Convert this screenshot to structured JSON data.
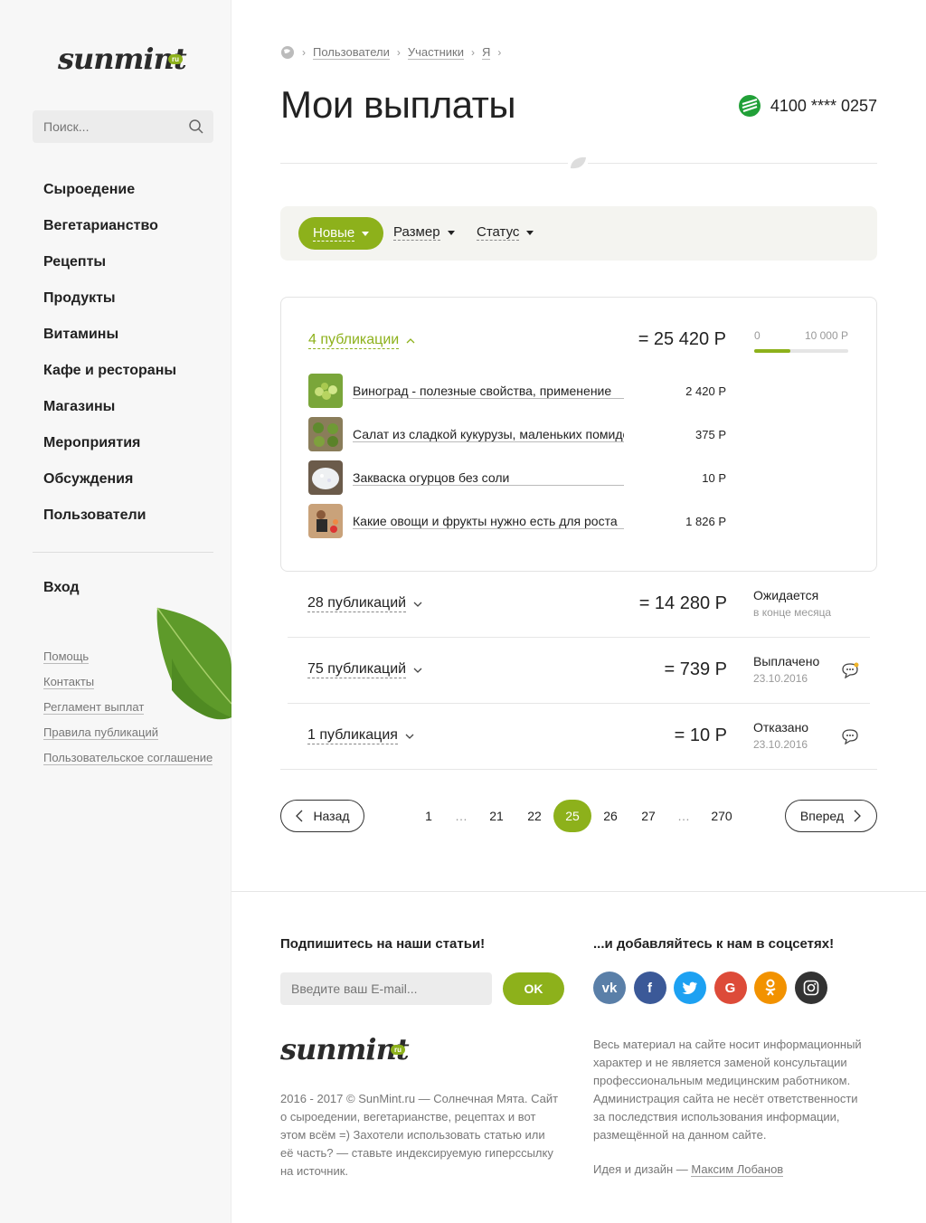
{
  "sidebar": {
    "logo_text": "sunmint",
    "logo_badge": "ru",
    "search_placeholder": "Поиск...",
    "nav": [
      "Сыроедение",
      "Вегетарианство",
      "Рецепты",
      "Продукты",
      "Витамины",
      "Кафе и рестораны",
      "Магазины",
      "Мероприятия",
      "Обсуждения",
      "Пользователи"
    ],
    "login": "Вход",
    "links": [
      "Помощь",
      "Контакты",
      "Регламент выплат",
      "Правила публикаций",
      "Пользовательское соглашение"
    ]
  },
  "breadcrumb": [
    "Пользователи",
    "Участники",
    "Я"
  ],
  "page_title": "Мои выплаты",
  "card_number": "4100 **** 0257",
  "filters": {
    "new": "Новые",
    "size": "Размер",
    "status": "Статус"
  },
  "expanded_group": {
    "label": "4 публикации",
    "amount": "= 25 420 Р",
    "progress": {
      "min": "0",
      "max": "10 000 Р",
      "fraction": 0.38
    },
    "items": [
      {
        "title": "Виноград - полезные свойства, применение",
        "value": "2 420 Р"
      },
      {
        "title": "Салат из сладкой кукурузы, маленьких помидоров",
        "value": "375 Р"
      },
      {
        "title": "Закваска огурцов без соли",
        "value": "10 Р"
      },
      {
        "title": "Какие овощи и фрукты нужно есть для роста",
        "value": "1 826 Р"
      }
    ]
  },
  "groups": [
    {
      "label": "28 публикаций",
      "amount": "= 14 280 Р",
      "status": "Ожидается",
      "sub": "в конце месяца"
    },
    {
      "label": "75 публикаций",
      "amount": "= 739 Р",
      "status": "Выплачено",
      "sub": "23.10.2016"
    },
    {
      "label": "1 публикация",
      "amount": "= 10 Р",
      "status": "Отказано",
      "sub": "23.10.2016"
    }
  ],
  "pager": {
    "prev": "Назад",
    "next": "Вперед",
    "pages": [
      "1",
      "…",
      "21",
      "22",
      "25",
      "26",
      "27",
      "…",
      "270"
    ],
    "current": "25"
  },
  "footer": {
    "subscribe_heading": "Подпишитесь на наши статьи!",
    "social_heading": "...и добавляйтесь к нам в соцсетях!",
    "email_placeholder": "Введите ваш E-mail...",
    "ok": "OK",
    "copyright": "2016 - 2017 © SunMint.ru — Солнечная Мята. Сайт о сыроедении, вегетарианстве, рецептах и вот этом всём =) Захотели использовать статью или её часть? — ставьте индексируемую гиперссылку на источник.",
    "disclaimer": "Весь материал на сайте носит информационный характер и не является заменой консультации профессиональным медицинским работником. Администрация сайта не несёт ответственности за последствия использования информации, размещённой на данном сайте.",
    "credit_prefix": "Идея и дизайн —",
    "credit_name": "Максим Лобанов"
  },
  "colors": {
    "accent": "#8db11b",
    "sberbank": "#21a038"
  }
}
